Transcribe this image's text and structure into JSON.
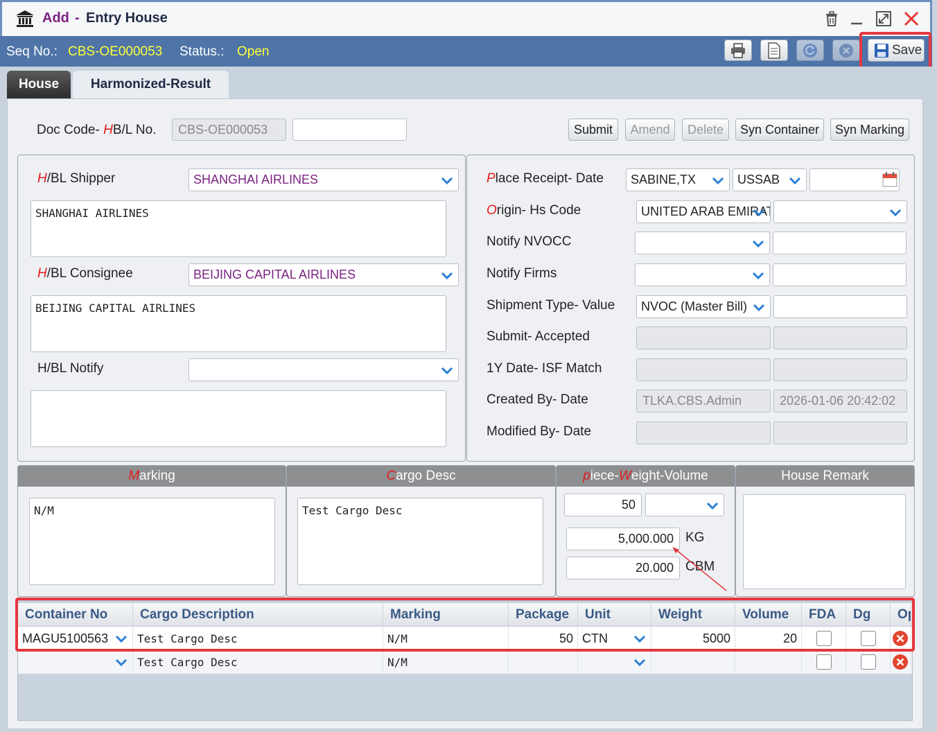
{
  "window": {
    "mode": "Add",
    "dash": "-",
    "title": "Entry House"
  },
  "seqbar": {
    "seq_label": "Seq No.:",
    "seq_value": "CBS-OE000053",
    "status_label": "Status.:",
    "status_value": "Open",
    "save_label": "Save"
  },
  "tabs": [
    {
      "label": "House"
    },
    {
      "label": "Harmonized-Result"
    }
  ],
  "doc": {
    "label_prefix": "Doc Code- ",
    "label_h": "H",
    "label_suffix": "B/L No.",
    "doc_code": "CBS-OE000053",
    "hbl_no": ""
  },
  "actions": {
    "submit": "Submit",
    "amend": "Amend",
    "delete": "Delete",
    "syn_container": "Syn Container",
    "syn_marking": "Syn Marking"
  },
  "shipper": {
    "label_h": "H",
    "label_rest": "/BL Shipper",
    "select_value": "SHANGHAI AIRLINES",
    "text": "SHANGHAI AIRLINES"
  },
  "consignee": {
    "label_h": "H",
    "label_rest": "/BL Consignee",
    "select_value": "BEIJING CAPITAL AIRLINES",
    "text": "BEIJING CAPITAL AIRLINES"
  },
  "notify": {
    "label": "H/BL Notify",
    "select_value": "",
    "text": ""
  },
  "right": {
    "place_p": "P",
    "place_rest": "lace Receipt- Date",
    "place_value": "SABINE,TX",
    "place_code": "USSAB",
    "place_date": "",
    "origin_o": "O",
    "origin_rest": "rigin- Hs Code",
    "origin_value": "UNITED ARAB EMIRATES",
    "hs_code": "",
    "notify_nvocc": "Notify NVOCC",
    "notify_firms": "Notify Firms",
    "shipment_type": "Shipment Type- Value",
    "shipment_value": "NVOC (Master Bill)",
    "shipment_extra": "",
    "submit_accepted": "Submit- Accepted",
    "isf_match": "1Y Date- ISF Match",
    "created_by": "Created By- Date",
    "created_by_value": "TLKA.CBS.Admin",
    "created_date": "2026-01-06 20:42:02",
    "modified_by": "Modified By- Date"
  },
  "sections": {
    "marking_m": "M",
    "marking_rest": "arking",
    "marking_text": "N/M",
    "cargo_c": "C",
    "cargo_rest": "argo Desc",
    "cargo_text": "Test Cargo Desc",
    "pwv_p": "p",
    "pwv_mid": "iece-",
    "pwv_w": "W",
    "pwv_rest": "eight-Volume",
    "pieces": "50",
    "unit": "",
    "weight": "5,000.000",
    "weight_unit": "KG",
    "volume": "20.000",
    "volume_unit": "CBM",
    "remark_label": "House Remark",
    "remark_text": ""
  },
  "grid": {
    "columns": [
      "Container No",
      "Cargo Description",
      "Marking",
      "Package",
      "Unit",
      "Weight",
      "Volume",
      "FDA",
      "Dg",
      "Op"
    ],
    "rows": [
      {
        "container": "MAGU5100563",
        "cargo": "Test Cargo Desc",
        "marking": "N/M",
        "package": "50",
        "unit": "CTN",
        "weight": "5000",
        "volume": "20"
      },
      {
        "container": "",
        "cargo": "Test Cargo Desc",
        "marking": "N/M",
        "package": "",
        "unit": "",
        "weight": "",
        "volume": ""
      }
    ]
  },
  "colors": {
    "accent": "#4e74a8",
    "highlight": "#e5373f",
    "purple": "#7b2282",
    "yellow": "#ffff3a"
  }
}
